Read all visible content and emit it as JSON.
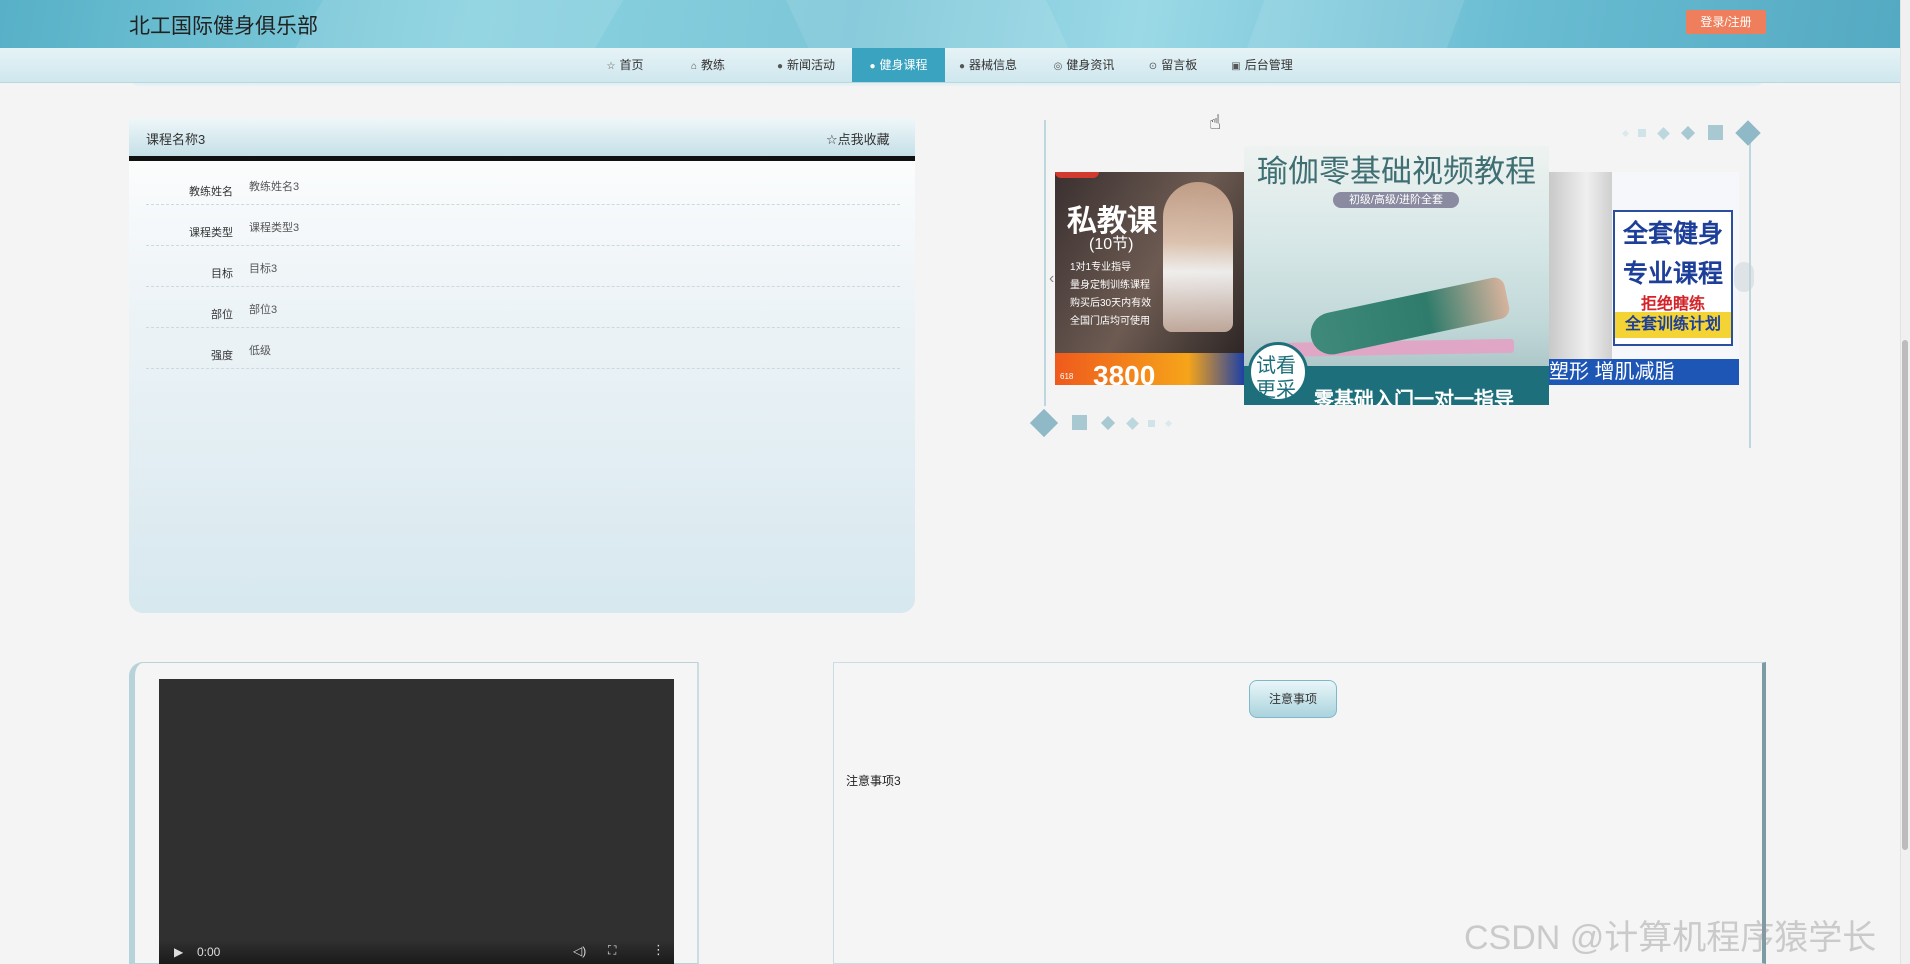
{
  "header": {
    "site_title": "北工国际健身俱乐部",
    "login_label": "登录/注册"
  },
  "nav": {
    "items": [
      {
        "label": "首页",
        "icon": "star-icon"
      },
      {
        "label": "教练",
        "icon": "home-icon"
      },
      {
        "label": "新闻活动",
        "icon": "info-icon"
      },
      {
        "label": "健身课程",
        "icon": "question-icon",
        "active": true
      },
      {
        "label": "器械信息",
        "icon": "info-icon"
      },
      {
        "label": "健身资讯",
        "icon": "globe-icon"
      },
      {
        "label": "留言板",
        "icon": "comment-icon"
      },
      {
        "label": "后台管理",
        "icon": "dashboard-icon"
      }
    ]
  },
  "course": {
    "name": "课程名称3",
    "favorite_label": "☆点我收藏",
    "fields": [
      {
        "label": "教练姓名",
        "value": "教练姓名3"
      },
      {
        "label": "课程类型",
        "value": "课程类型3"
      },
      {
        "label": "目标",
        "value": "目标3"
      },
      {
        "label": "部位",
        "value": "部位3"
      },
      {
        "label": "强度",
        "value": "低级"
      }
    ]
  },
  "carousel": {
    "slide_1": {
      "title": "私教课",
      "subtitle": "(10节)",
      "lines": [
        "1对1专业指导",
        "量身定制训练课程",
        "购买后30天内有效",
        "全国门店均可使用"
      ],
      "price": "3800",
      "tag": "618"
    },
    "slide_2": {
      "title": "瑜伽零基础视频教程",
      "subtitle": "初级/高级/进阶全套",
      "badge_line1": "试看",
      "badge_line2": "更采",
      "bottom": "零基础入门一对一指导"
    },
    "slide_3": {
      "line1": "全套健身",
      "line2": "专业课程",
      "line3": "拒绝瞎练",
      "line4": "全套训练计划",
      "bottom": "塑形 增肌减脂"
    }
  },
  "video": {
    "time": "0:00"
  },
  "notes": {
    "title": "注意事项",
    "body": "注意事项3"
  },
  "watermark": "CSDN @计算机程序猿学长",
  "colors": {
    "accent": "#3aa3bf",
    "login_button": "#ef7f5c"
  }
}
